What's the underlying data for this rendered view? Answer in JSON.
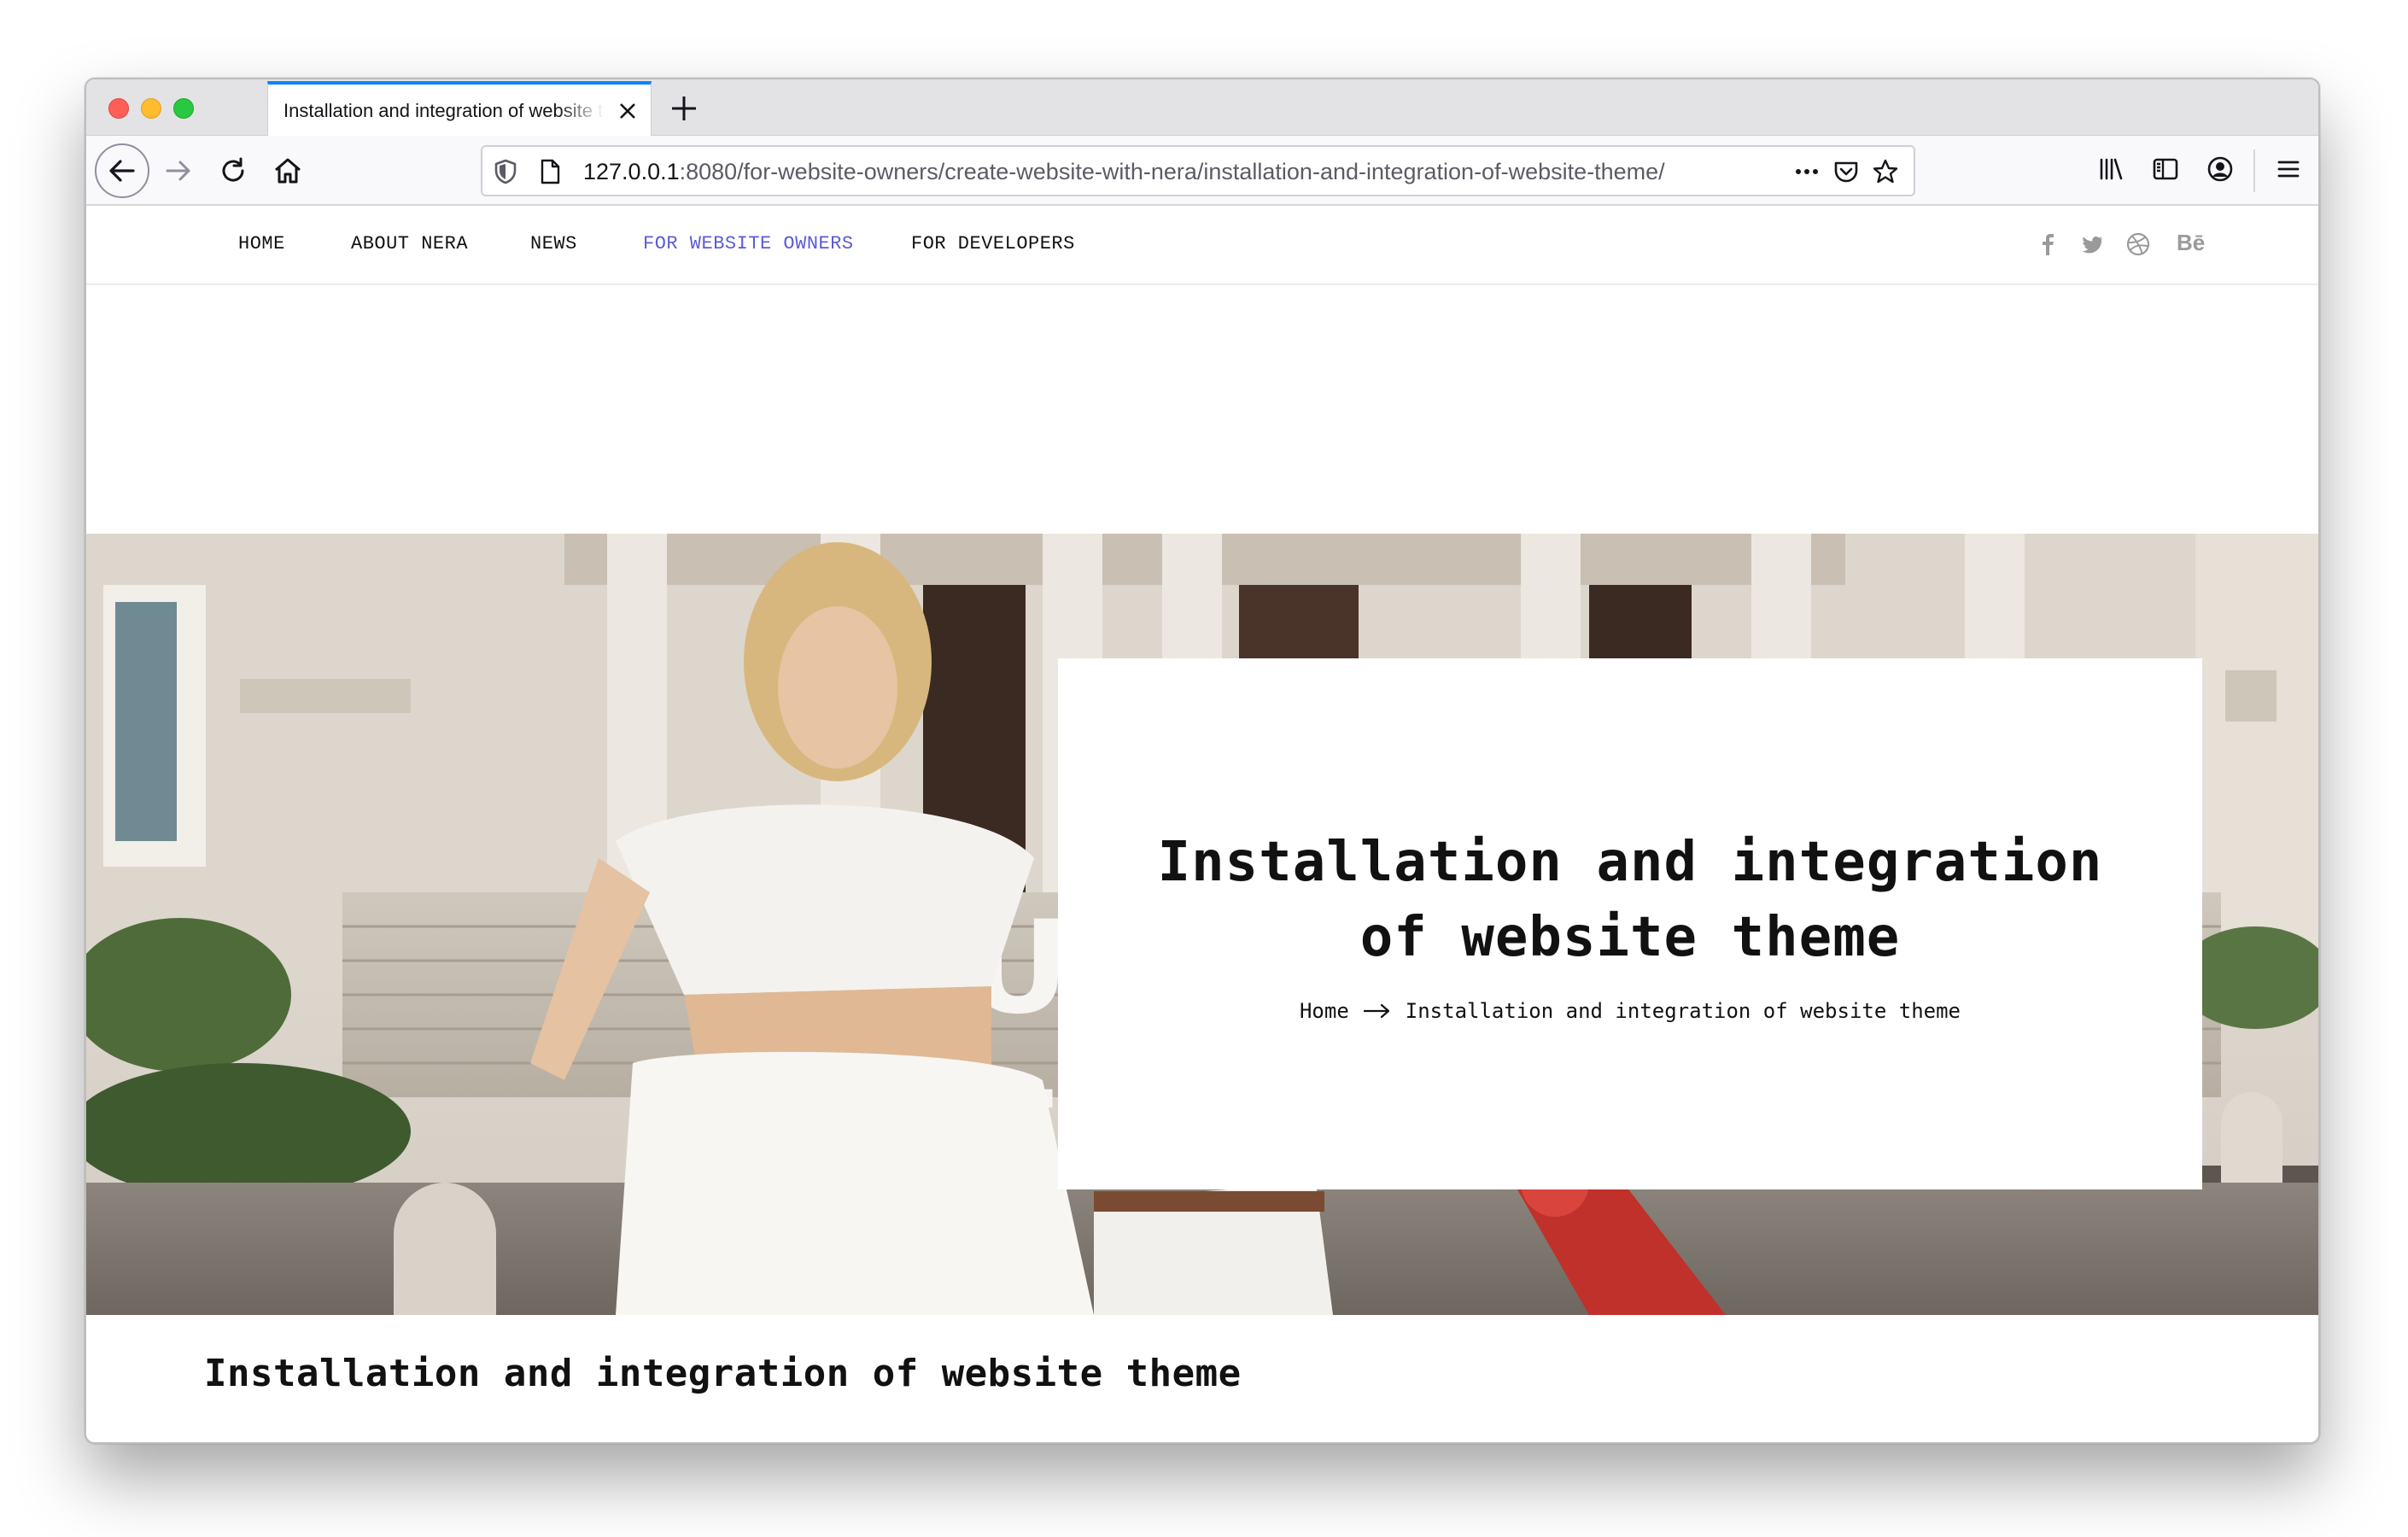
{
  "browser": {
    "tab": {
      "title": "Installation and integration of website theme"
    },
    "url": {
      "host": "127.0.0.1",
      "rest": ":8080/for-website-owners/create-website-with-nera/installation-and-integration-of-website-theme/"
    },
    "icons": [
      "back-arrow-icon",
      "forward-arrow-icon",
      "reload-icon",
      "home-icon",
      "shield-icon",
      "page-icon",
      "more-icon",
      "pocket-icon",
      "star-icon",
      "library-icon",
      "sidebar-icon",
      "account-icon",
      "menu-icon",
      "close-icon",
      "plus-icon"
    ]
  },
  "site": {
    "menu": [
      {
        "label": "HOME"
      },
      {
        "label": "ABOUT NERA"
      },
      {
        "label": "NEWS"
      },
      {
        "label": "FOR WEBSITE OWNERS",
        "active": true
      },
      {
        "label": "FOR DEVELOPERS"
      }
    ],
    "social": {
      "behance": "Bē"
    },
    "accent_color": "#5b5bd6"
  },
  "hero": {
    "title": "Installation and integration of website theme",
    "breadcrumb": {
      "home": "Home",
      "current": "Installation and integration of website theme"
    }
  },
  "content": {
    "heading": "Installation and integration of website theme"
  }
}
